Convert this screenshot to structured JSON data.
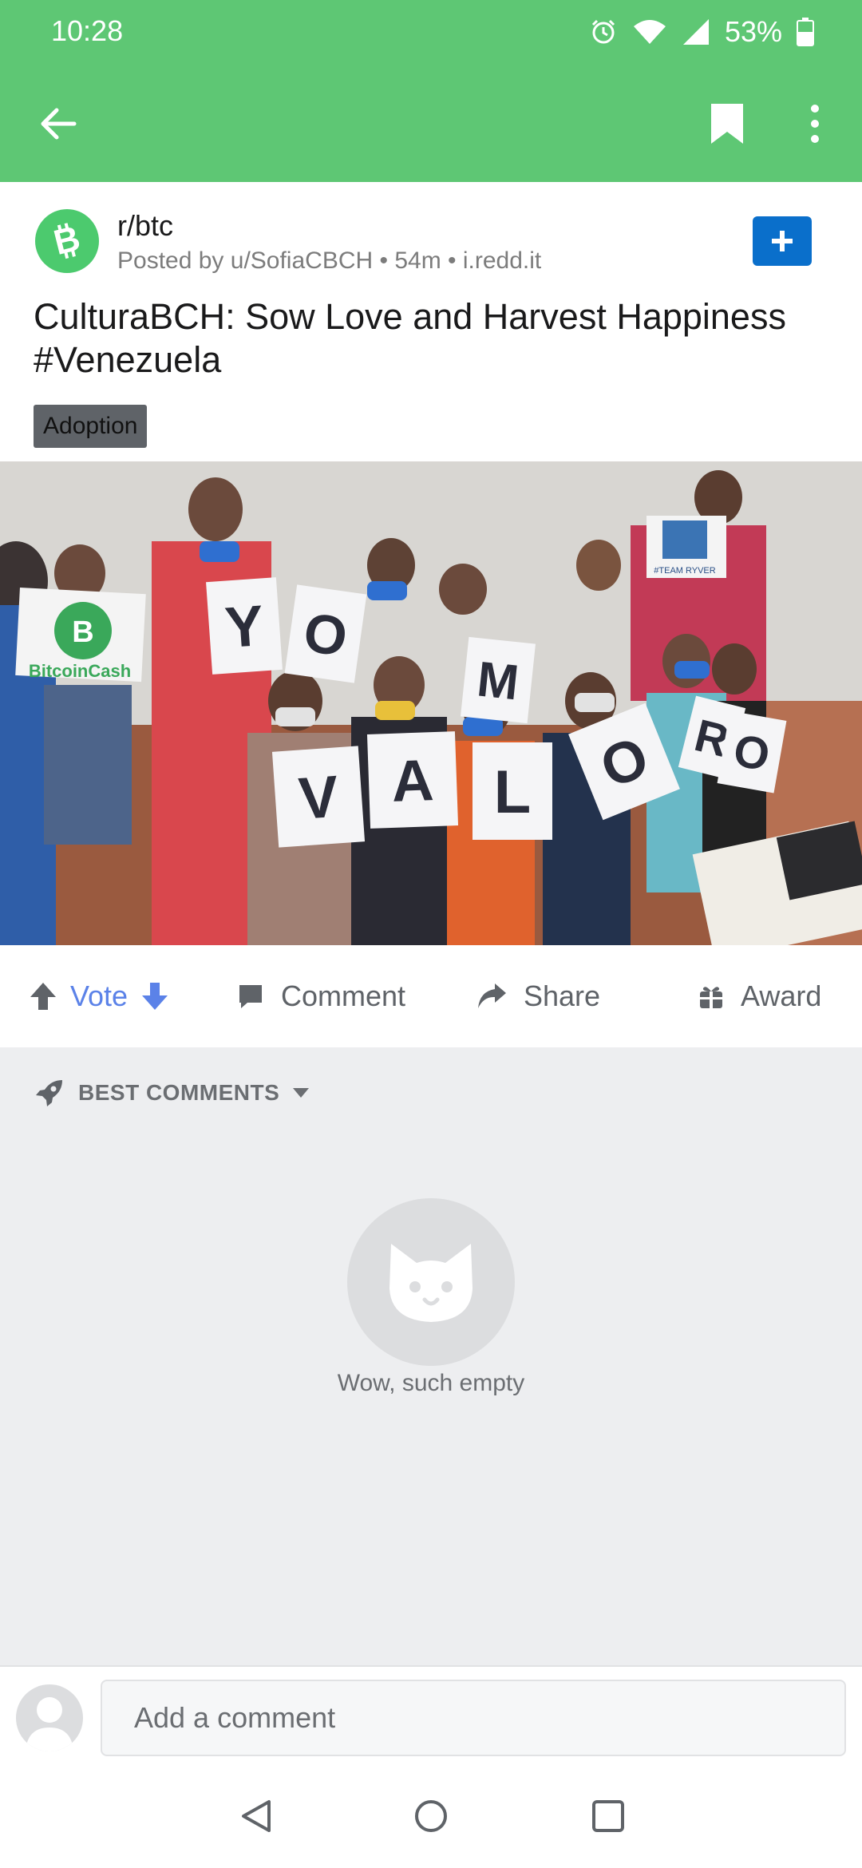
{
  "status_bar": {
    "time": "10:28",
    "battery": "53%"
  },
  "app_bar": {
    "back_icon": "arrow-left-icon",
    "bookmark_icon": "bookmark-icon",
    "more_icon": "more-vertical-icon"
  },
  "post": {
    "subreddit": "r/btc",
    "meta": "Posted by u/SofiaCBCH • 54m • i.redd.it",
    "title": "CulturaBCH: Sow Love and Harvest Happiness #Venezuela",
    "flair": "Adoption",
    "image_signs": {
      "logo_text": "BitcoinCash",
      "banner_text": "#TEAM RYVER",
      "top_row": [
        "Y",
        "O",
        "M"
      ],
      "bottom_row": [
        "V",
        "A",
        "L",
        "O",
        "R",
        "O"
      ]
    }
  },
  "actions": {
    "vote": "Vote",
    "comment": "Comment",
    "share": "Share",
    "award": "Award"
  },
  "comments": {
    "sort_label": "BEST COMMENTS",
    "empty_text": "Wow, such empty"
  },
  "comment_box": {
    "placeholder": "Add a comment"
  },
  "colors": {
    "header_green": "#5ec774",
    "vote_blue": "#5b82e8",
    "join_blue": "#0a6fcb",
    "background": "#edeef0"
  }
}
